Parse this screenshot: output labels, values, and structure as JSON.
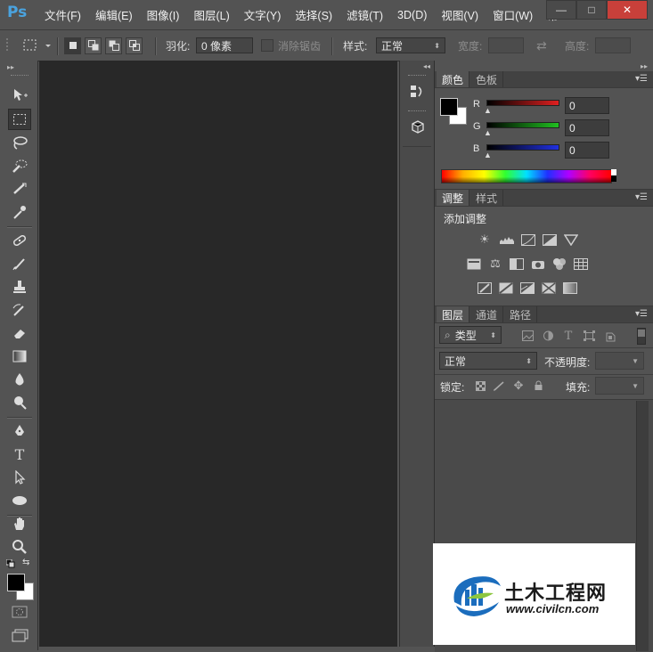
{
  "app": {
    "logo": "Ps"
  },
  "menu": [
    "文件(F)",
    "编辑(E)",
    "图像(I)",
    "图层(L)",
    "文字(Y)",
    "选择(S)",
    "滤镜(T)",
    "3D(D)",
    "视图(V)",
    "窗口(W)",
    "帮"
  ],
  "window_buttons": {
    "minimize": "—",
    "maximize": "□",
    "close": "✕"
  },
  "options": {
    "feather_label": "羽化:",
    "feather_value": "0 像素",
    "antialias_label": "消除锯齿",
    "style_label": "样式:",
    "style_value": "正常",
    "width_label": "宽度:",
    "height_label": "高度:"
  },
  "color_panel": {
    "tabs": [
      "颜色",
      "色板"
    ],
    "channels": [
      {
        "label": "R",
        "value": "0",
        "color": "#e02020"
      },
      {
        "label": "G",
        "value": "0",
        "color": "#20c020"
      },
      {
        "label": "B",
        "value": "0",
        "color": "#2030e0"
      }
    ],
    "foreground": "#000000",
    "background": "#ffffff"
  },
  "adjust_panel": {
    "tabs": [
      "调整",
      "样式"
    ],
    "heading": "添加调整"
  },
  "layers_panel": {
    "tabs": [
      "图层",
      "通道",
      "路径"
    ],
    "filter_label": "类型",
    "blend_mode": "正常",
    "opacity_label": "不透明度:",
    "lock_label": "锁定:",
    "fill_label": "填充:"
  },
  "watermark": {
    "name": "土木工程网",
    "url": "www.civilcn.com"
  }
}
